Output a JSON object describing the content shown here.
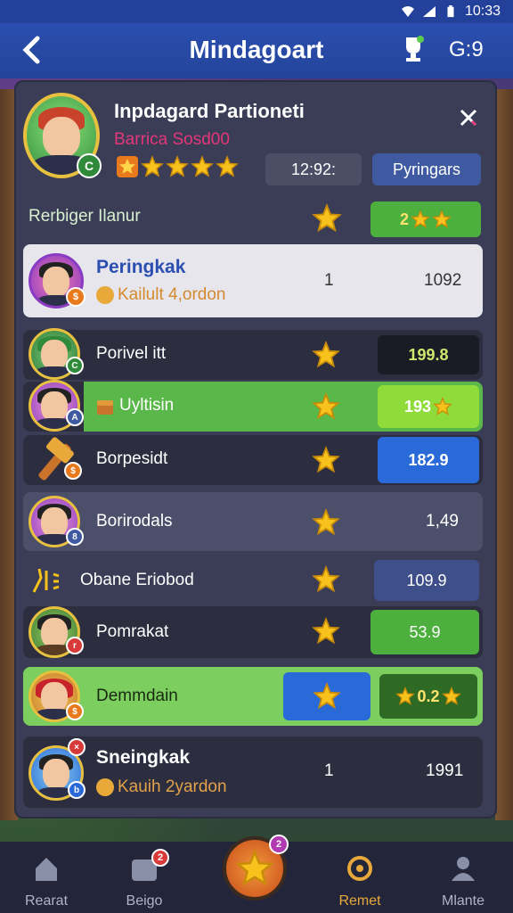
{
  "status": {
    "time": "10:33"
  },
  "header": {
    "title": "Mindagoart",
    "right": "G:9"
  },
  "profile": {
    "name": "Inpdagard Partioneti",
    "subtitle": "Barrica Sosd00",
    "stars": 4,
    "time": "12:92:",
    "rank_button": "Pyringars"
  },
  "reward": {
    "label": "Rerbiger Ilanur",
    "value": "2"
  },
  "rows": [
    {
      "name": "Peringkak",
      "sub": "Kailult 4,ordon",
      "rank": "1",
      "score": "1092"
    },
    {
      "name": "Porivel itt",
      "score": "199.8"
    },
    {
      "name": "Uyltisin",
      "score": "193"
    },
    {
      "name": "Borpesidt",
      "score": "182.9"
    },
    {
      "name": "Borirodals",
      "score": "1,49"
    },
    {
      "name": "Obane Eriobod",
      "score": "109.9"
    },
    {
      "name": "Pomrakat",
      "score": "53.9"
    },
    {
      "name": "Demmdain",
      "score": "0.2"
    },
    {
      "name": "Sneingkak",
      "sub": "Kauih 2yardon",
      "rank": "1",
      "score": "1991"
    }
  ],
  "nav": [
    {
      "label": "Rearat",
      "icon": "home-icon"
    },
    {
      "label": "Beigo",
      "icon": "badge-icon",
      "badge": "2"
    },
    {
      "label": "",
      "icon": "star-icon",
      "badge": "2"
    },
    {
      "label": "Remet",
      "icon": "gear-icon"
    },
    {
      "label": "Mlante",
      "icon": "user-icon"
    }
  ],
  "colors": {
    "accent": "#2b4fb0",
    "green": "#4caf3e",
    "gold": "#f6c21b"
  }
}
